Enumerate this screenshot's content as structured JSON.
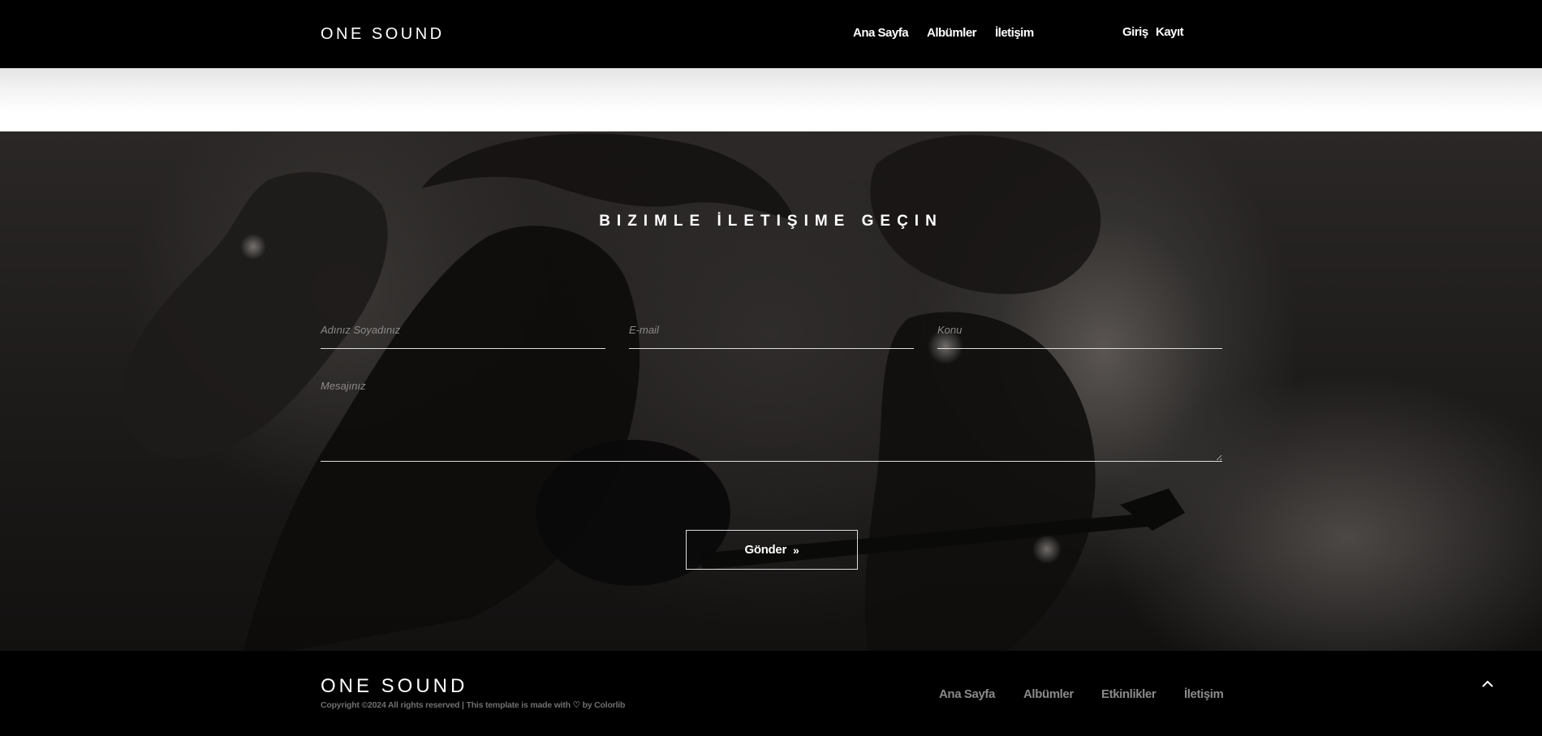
{
  "header": {
    "logo": "ONE SOUND",
    "nav": [
      {
        "label": "Ana Sayfa"
      },
      {
        "label": "Albümler"
      },
      {
        "label": "İletişim"
      }
    ],
    "auth": {
      "login": "Giriş",
      "register": "Kayıt"
    }
  },
  "contact": {
    "title": "BIZIMLE İLETIŞIME GEÇIN",
    "name_placeholder": "Adınız Soyadınız",
    "email_placeholder": "E-mail",
    "subject_placeholder": "Konu",
    "message_placeholder": "Mesajınız",
    "submit_label": "Gönder",
    "submit_icon": "double-chevron-right-icon"
  },
  "footer": {
    "logo": "ONE SOUND",
    "copyright_prefix": "Copyright ©2024 All rights reserved | This template is made with",
    "copyright_suffix": "by Colorlib",
    "heart_icon": "heart-icon",
    "links": [
      {
        "label": "Ana Sayfa"
      },
      {
        "label": "Albümler"
      },
      {
        "label": "Etkinlikler"
      },
      {
        "label": "İletişim"
      }
    ],
    "to_top_icon": "chevron-up-icon"
  },
  "colors": {
    "header_bg": "#000000",
    "text": "#ffffff",
    "footer_link": "#8a8a8a",
    "muted": "#6f6f6f"
  }
}
